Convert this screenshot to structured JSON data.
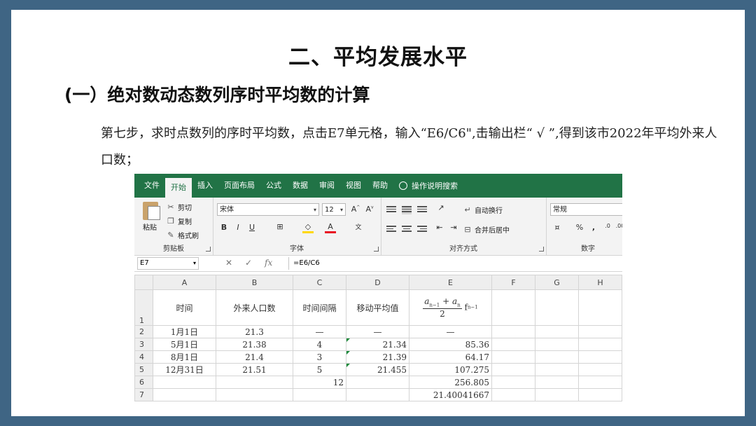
{
  "slide": {
    "title": "二、平均发展水平",
    "subtitle": "(一）绝对数动态数列序时平均数的计算",
    "paragraph": "第七步，求时点数列的序时平均数，点击E7单元格，输入“E6/C6\",击输出栏“ √ ”,得到该市2022年平均外来人口数；"
  },
  "excel": {
    "colors": {
      "ribbon_green": "#217346",
      "ribbon_bg": "#f3f3f3"
    },
    "tabs": [
      "文件",
      "开始",
      "插入",
      "页面布局",
      "公式",
      "数据",
      "审阅",
      "视图",
      "帮助"
    ],
    "active_tab": "开始",
    "tell_me": "操作说明搜索",
    "clipboard": {
      "paste": "粘贴",
      "cut": "剪切",
      "copy": "复制",
      "format_painter": "格式刷",
      "group_label": "剪贴板"
    },
    "font": {
      "name": "宋体",
      "size": "12",
      "bold": "B",
      "italic": "I",
      "underline": "U",
      "group_label": "字体"
    },
    "alignment": {
      "wrap": "自动换行",
      "merge": "合并后居中",
      "group_label": "对齐方式"
    },
    "number": {
      "format": "常规",
      "percent": "%",
      "comma": ",",
      "group_label": "数字"
    },
    "formula_bar": {
      "name_box": "E7",
      "fx": "fx",
      "formula": "=E6/C6"
    },
    "columns": [
      "A",
      "B",
      "C",
      "D",
      "E",
      "F",
      "G",
      "H"
    ],
    "rows": [
      {
        "num": "1",
        "cells": [
          "时间",
          "外来人口数",
          "时间间隔",
          "移动平均值",
          "",
          "",
          "",
          ""
        ]
      },
      {
        "num": "2",
        "cells": [
          "1月1日",
          "21.3",
          "—",
          "—",
          "—",
          "",
          "",
          ""
        ]
      },
      {
        "num": "3",
        "cells": [
          "5月1日",
          "21.38",
          "4",
          "21.34",
          "85.36",
          "",
          "",
          ""
        ]
      },
      {
        "num": "4",
        "cells": [
          "8月1日",
          "21.4",
          "3",
          "21.39",
          "64.17",
          "",
          "",
          ""
        ]
      },
      {
        "num": "5",
        "cells": [
          "12月31日",
          "21.51",
          "5",
          "21.455",
          "107.275",
          "",
          "",
          ""
        ]
      },
      {
        "num": "6",
        "cells": [
          "",
          "",
          "12",
          "",
          "256.805",
          "",
          "",
          ""
        ]
      },
      {
        "num": "7",
        "cells": [
          "",
          "",
          "",
          "",
          "21.40041667",
          "",
          "",
          ""
        ]
      }
    ],
    "e1_formula": {
      "a1": "a",
      "s1": "n−1",
      "plus": "+",
      "a2": "a",
      "s2": "n",
      "den": "2",
      "f": "f",
      "fs": "n−1"
    }
  }
}
